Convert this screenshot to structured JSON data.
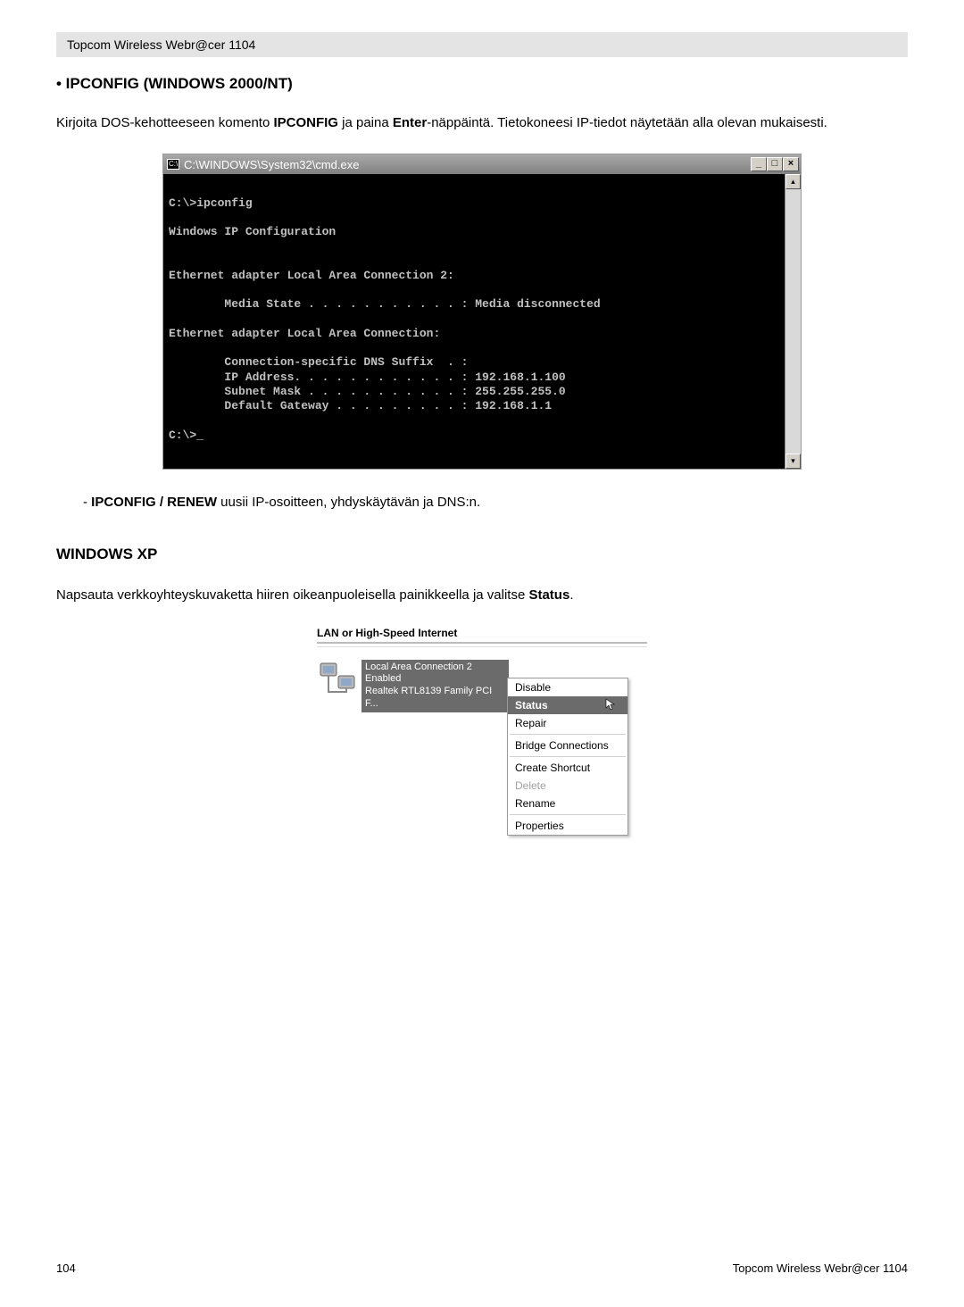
{
  "header": {
    "title": "Topcom Wireless Webr@cer 1104"
  },
  "section1": {
    "title": "• IPCONFIG (WINDOWS 2000/NT)",
    "para_parts": {
      "p1": "Kirjoita DOS-kehotteeseen  komento ",
      "b1": "IPCONFIG",
      "p2": " ja paina ",
      "b2": "Enter",
      "p3": "-näppäintä. Tietokoneesi IP-tiedot näytetään alla olevan mukaisesti."
    }
  },
  "cmd": {
    "title": "C:\\WINDOWS\\System32\\cmd.exe",
    "icon_label": "C:\\",
    "body": "\nC:\\>ipconfig\n\nWindows IP Configuration\n\n\nEthernet adapter Local Area Connection 2:\n\n        Media State . . . . . . . . . . . : Media disconnected\n\nEthernet adapter Local Area Connection:\n\n        Connection-specific DNS Suffix  . :\n        IP Address. . . . . . . . . . . . : 192.168.1.100\n        Subnet Mask . . . . . . . . . . . : 255.255.255.0\n        Default Gateway . . . . . . . . . : 192.168.1.1\n\nC:\\>_",
    "buttons": {
      "min": "_",
      "max": "□",
      "close": "×"
    },
    "scroll": {
      "up": "▴",
      "down": "▾"
    }
  },
  "subnote": {
    "prefix": "- ",
    "bold": "IPCONFIG / RENEW",
    "rest": " uusii IP-osoitteen, yhdyskäytävän ja DNS:n."
  },
  "section2": {
    "title": "WINDOWS XP",
    "para_parts": {
      "p1": "Napsauta verkkoyhteyskuvaketta hiiren oikeanpuoleisella painikkeella ja valitse ",
      "b1": "Status",
      "p2": "."
    }
  },
  "xp": {
    "category": "LAN or High-Speed Internet",
    "connection": {
      "name": "Local Area Connection 2",
      "state": "Enabled",
      "device": "Realtek RTL8139 Family PCI F..."
    },
    "menu": {
      "disable": "Disable",
      "status": "Status",
      "repair": "Repair",
      "bridge": "Bridge Connections",
      "shortcut": "Create Shortcut",
      "delete": "Delete",
      "rename": "Rename",
      "properties": "Properties"
    },
    "cursor": "↖"
  },
  "footer": {
    "page": "104",
    "product": "Topcom Wireless Webr@cer 1104"
  }
}
